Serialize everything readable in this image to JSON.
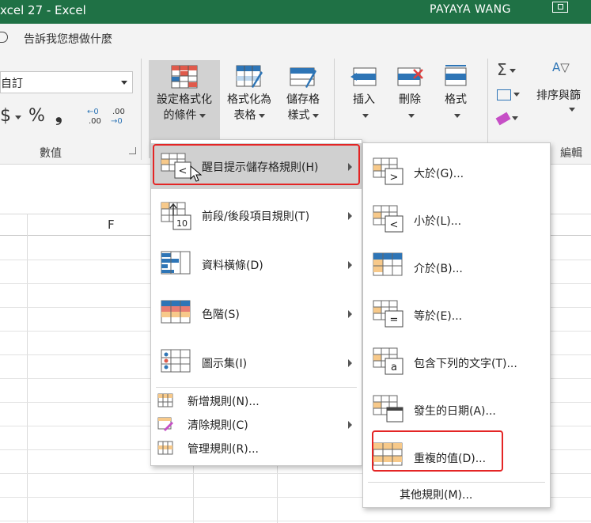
{
  "window": {
    "title": "xcel 27  -  Excel",
    "user": "PAYAYA WANG"
  },
  "tell_me": {
    "text": "告訴我您想做什麼"
  },
  "number_group": {
    "format_value": "自訂",
    "currency_symbol": "$",
    "percent_symbol": "%",
    "comma_symbol": "❟",
    "increase_decimal_top": "←0",
    "increase_decimal_bottom": ".00",
    "decrease_decimal_top": ".00",
    "decrease_decimal_bottom": "→0",
    "label": "數值"
  },
  "styles_group": {
    "conditional_formatting": {
      "line1": "設定格式化",
      "line2": "的條件"
    },
    "format_as_table": {
      "line1": "格式化為",
      "line2": "表格"
    },
    "cell_styles": {
      "line1": "儲存格",
      "line2": "樣式"
    }
  },
  "cells_group": {
    "insert": "插入",
    "delete": "刪除",
    "format": "格式"
  },
  "editing_group": {
    "autosum_icon": "Σ",
    "sort_filter": "排序與篩",
    "label": "編輯"
  },
  "sheet": {
    "column_F": "F"
  },
  "cf_menu": {
    "items": [
      {
        "label": "醒目提示儲存格規則(H)",
        "has_submenu": true
      },
      {
        "label": "前段/後段項目規則(T)",
        "has_submenu": true
      },
      {
        "label": "資料橫條(D)",
        "has_submenu": true
      },
      {
        "label": "色階(S)",
        "has_submenu": true
      },
      {
        "label": "圖示集(I)",
        "has_submenu": true
      }
    ],
    "small_items": [
      {
        "label": "新增規則(N)..."
      },
      {
        "label": "清除規則(C)",
        "has_submenu": true
      },
      {
        "label": "管理規則(R)..."
      }
    ]
  },
  "highlight_submenu": {
    "items": [
      {
        "label": "大於(G)..."
      },
      {
        "label": "小於(L)..."
      },
      {
        "label": "介於(B)..."
      },
      {
        "label": "等於(E)..."
      },
      {
        "label": "包含下列的文字(T)..."
      },
      {
        "label": "發生的日期(A)..."
      },
      {
        "label": "重複的值(D)..."
      }
    ],
    "more_rules": "其他規則(M)..."
  },
  "colors": {
    "excel_green": "#1f7145",
    "highlight_red": "#e42525",
    "menu_hover": "#d0d0d0"
  }
}
